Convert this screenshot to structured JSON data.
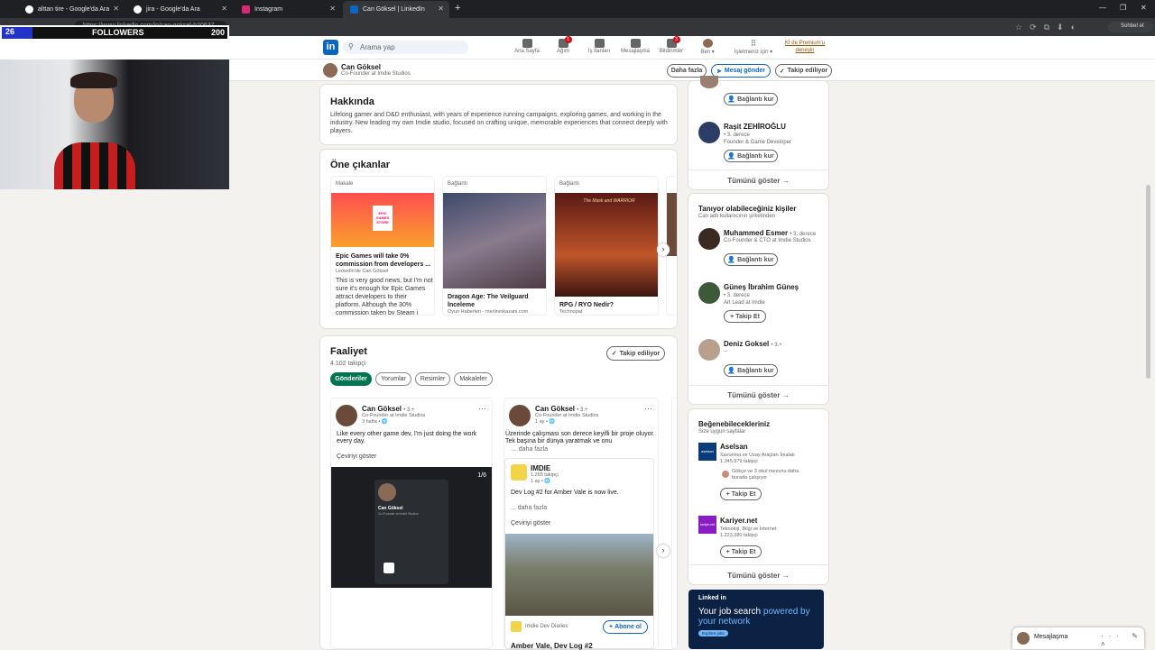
{
  "browser": {
    "tabs": [
      {
        "label": "alttan tire - Google'da Ara"
      },
      {
        "label": "jira - Google'da Ara"
      },
      {
        "label": "Instagram"
      },
      {
        "label": "Can Göksel | LinkedIn"
      }
    ],
    "url": "https://www.linkedin.com/in/can-goksel-b20637",
    "profile_label": "Sohbet et"
  },
  "overlay": {
    "count": "26",
    "label": "FOLLOWERS",
    "goal": "200"
  },
  "nav": {
    "search_placeholder": "Arama yap",
    "items": [
      {
        "label": "Ana Sayfa"
      },
      {
        "label": "Ağım",
        "badge": "1"
      },
      {
        "label": "İş İlanları"
      },
      {
        "label": "Mesajlaşma"
      },
      {
        "label": "Bildirimler",
        "badge": "3"
      },
      {
        "label": "Ben ▾"
      },
      {
        "label": "İşletmeniz için ▾"
      }
    ],
    "premium": "Kİ de Premium'u deneyin"
  },
  "profile_bar": {
    "name": "Can Göksel",
    "headline": "Co-Founder at Imdie Studios",
    "more": "Daha fazla",
    "message": "Mesaj gönder",
    "following": "Takip ediliyor"
  },
  "about": {
    "title": "Hakkında",
    "text": "Lifelong gamer and D&D enthusiast, with years of experience running campaigns, exploring games, and working in the industry. New leading my own Imdie studio, focused on crafting unique, memorable experiences that connect deeply with players."
  },
  "featured": {
    "title": "Öne çıkanlar",
    "items": [
      {
        "type": "Makale",
        "img_text": "EPIC GAMES STORE",
        "title": "Epic Games will take 0% commission from developers ...",
        "source": "LinkedIn'de Can Göksel",
        "desc": "This is very good news, but I'm not sure it's enough for Epic Games attract developers to their platform. Although the 30% commission taken by Steam i"
      },
      {
        "type": "Bağlantı",
        "img_text": "",
        "title": "Dragon Age: The Veilguard İnceleme",
        "source": "Oyun Haberleri - merlinınkazani.com",
        "desc": ""
      },
      {
        "type": "Bağlantı",
        "img_text": "The Mask and WARRIOR",
        "title": "RPG / RYO Nedir?",
        "source": "Technopat",
        "desc": ""
      }
    ]
  },
  "activity": {
    "title": "Faaliyet",
    "followers": "4.102 takipçi",
    "following_btn": "Takip ediliyor",
    "filters": [
      "Gönderiler",
      "Yorumlar",
      "Resimler",
      "Makaleler"
    ],
    "posts": [
      {
        "name": "Can Göksel",
        "degree": "• 3.+",
        "headline": "Co-Founder at Imdie Studios",
        "time": "3 hafta • 🌐",
        "text": "Like every other game dev, I'm just doing the work every day.",
        "translate": "Çeviriyi göster",
        "counter": "1/6",
        "shot_name": "Can Göksel",
        "shot_sub": "Co-Founder at Imdie Studios"
      },
      {
        "name": "Can Göksel",
        "degree": "• 3.+",
        "headline": "Co-Founder at Imdie Studios",
        "time": "1 ay • 🌐",
        "text": "Üzerinde çalışması son derece keyifli bir proje oluyor. Tek başına bir dünya yaratmak ve onu",
        "more": "... daha fazla",
        "shared_name": "IMDIE",
        "shared_followers": "1.265 takipçi",
        "shared_time": "1 ay • 🌐",
        "shared_text": "Dev Log #2 for Amber Vale is now live.",
        "shared_more": "... daha fazla",
        "translate": "Çeviriyi göster",
        "footer_name": "Imdie Dev Diaries",
        "subscribe": "Abone ol",
        "footer_title": "Amber Vale, Dev Log #2"
      }
    ]
  },
  "right": {
    "top_connect": "Bağlantı kur",
    "person1": {
      "name": "Raşit ZEHİROĞLU",
      "degree": "• 3. derece",
      "headline": "Founder & Game Developer",
      "btn": "Bağlantı kur"
    },
    "show_all": "Tümünü göster →",
    "pymk": {
      "title": "Tanıyor olabileceğiniz kişiler",
      "subtitle": "Can adlı kullanıcının şirketinden",
      "people": [
        {
          "name": "Muhammed Esmer",
          "degree": "• 3. derece",
          "headline": "Co-Founder & CTO at Imdie Studios",
          "btn": "Bağlantı kur"
        },
        {
          "name": "Güneş İbrahim Güneş",
          "degree": "• 3. derece",
          "headline": "Art Lead at Imdie",
          "btn": "Takip Et"
        },
        {
          "name": "Deniz Goksel",
          "degree": "• 3.+",
          "headline": "--",
          "btn": "Bağlantı kur"
        }
      ],
      "show_all": "Tümünü göster →"
    },
    "pages": {
      "title": "Beğenebilecekleriniz",
      "subtitle": "Size uygun sayfalar",
      "items": [
        {
          "name": "Aselsan",
          "desc": "Savunma ve Uzay Araçları İmalatı",
          "followers": "1.345.979 takipçi",
          "mutual": "Gökçe ve 3 okul mezunu daha burada çalışıyor",
          "btn": "Takip Et",
          "logo_text": "aselsan"
        },
        {
          "name": "Kariyer.net",
          "desc": "Teknoloji, Bilgi ve İnternet",
          "followers": "1.223.380 takipçi",
          "btn": "Takip Et",
          "logo_text": "kariyer.net"
        }
      ],
      "show_all": "Tümünü göster →"
    },
    "ad": {
      "brand": "Linked in",
      "line1": "Your job search",
      "line2": "powered by",
      "line3": "your network",
      "cta": "Explore jobs"
    }
  },
  "messaging": {
    "label": "Mesajlaşma"
  }
}
